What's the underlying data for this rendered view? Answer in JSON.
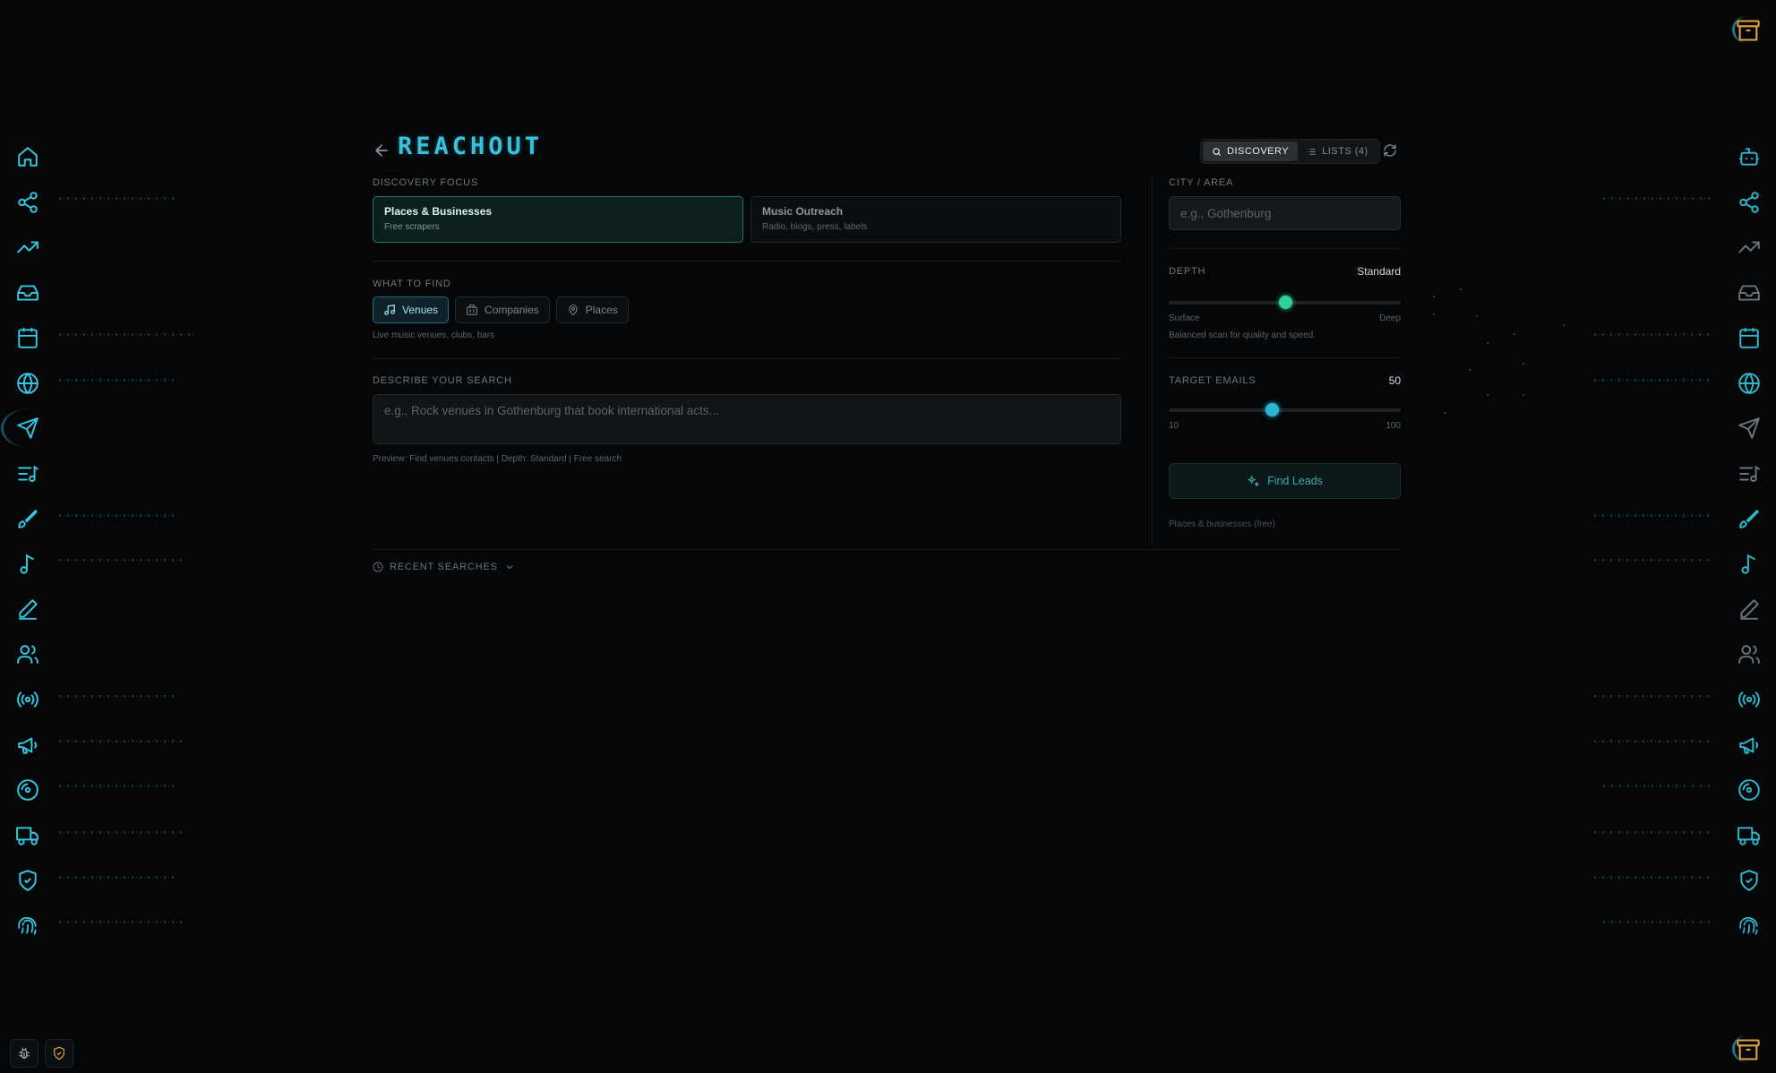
{
  "header": {
    "title": "REACHOUT",
    "tabs": [
      {
        "label": "DISCOVERY",
        "icon": "search-icon",
        "active": true
      },
      {
        "label": "LISTS (4)",
        "icon": "list-icon",
        "active": false
      }
    ]
  },
  "focus": {
    "label": "DISCOVERY FOCUS",
    "options": [
      {
        "title": "Places & Businesses",
        "subtitle": "Free scrapers",
        "selected": true
      },
      {
        "title": "Music Outreach",
        "subtitle": "Radio, blogs, press, labels",
        "selected": false
      }
    ]
  },
  "find": {
    "label": "WHAT TO FIND",
    "options": [
      {
        "label": "Venues",
        "icon": "music-note-icon",
        "selected": true
      },
      {
        "label": "Companies",
        "icon": "building-icon",
        "selected": false
      },
      {
        "label": "Places",
        "icon": "map-pin-icon",
        "selected": false
      }
    ],
    "hint": "Live music venues, clubs, bars"
  },
  "describe": {
    "label": "DESCRIBE YOUR SEARCH",
    "placeholder": "e.g., Rock venues in Gothenburg that book international acts...",
    "preview": "Preview: Find venues contacts | Depth: Standard | Free search"
  },
  "city": {
    "label": "CITY / AREA",
    "placeholder": "e.g., Gothenburg"
  },
  "depth": {
    "label": "DEPTH",
    "value_label": "Standard",
    "level": 0.5,
    "min_label": "Surface",
    "max_label": "Deep",
    "description": "Balanced scan for quality and speed."
  },
  "emails": {
    "label": "TARGET EMAILS",
    "value": "50",
    "min": "10",
    "max": "100",
    "level": 0.444
  },
  "action": {
    "label": "Find Leads",
    "note": "Places & businesses (free)"
  },
  "recent": {
    "label": "RECENT SEARCHES"
  },
  "colors": {
    "accent": "#36c2dc",
    "selected_green": "#1c7a6a",
    "depth_thumb": "#2ecf9a",
    "emails_thumb": "#2bb7d4",
    "archive": "#e0a23a"
  },
  "rail_icons_left": [
    "home-icon",
    "share-icon",
    "trending-up-icon",
    "inbox-icon",
    "calendar-icon",
    "globe-icon",
    "send-icon",
    "music-list-icon",
    "brush-icon",
    "music-note-icon",
    "pen-icon",
    "users-icon",
    "radio-icon",
    "megaphone-icon",
    "disc-icon",
    "truck-icon",
    "shield-check-icon",
    "fingerprint-icon"
  ],
  "rail_icons_right": [
    "bot-icon",
    "share-icon",
    "trending-up-icon",
    "inbox-icon",
    "calendar-icon",
    "globe-icon",
    "send-icon",
    "music-list-icon",
    "brush-icon",
    "music-note-icon",
    "pen-icon",
    "users-icon",
    "radio-icon",
    "megaphone-icon",
    "disc-icon",
    "truck-icon",
    "shield-check-icon",
    "fingerprint-icon"
  ]
}
